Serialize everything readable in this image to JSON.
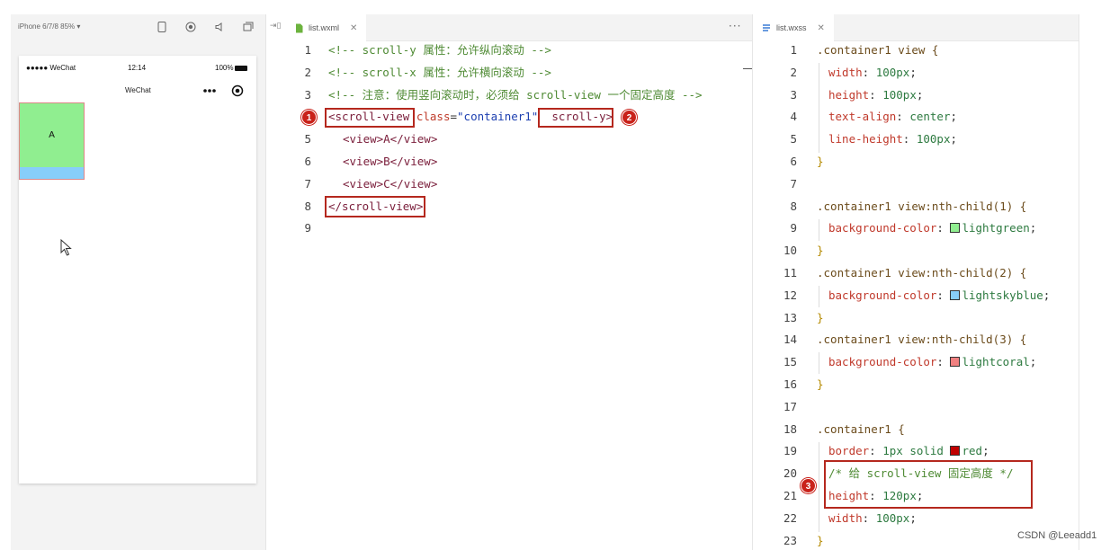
{
  "simulator": {
    "device_label": "iPhone 6/7/8 85% ▾",
    "status": {
      "carrier": "●●●●● WeChat",
      "time": "12:14",
      "battery": "100%"
    },
    "nav_title": "WeChat",
    "view_a_text": "A"
  },
  "wxml": {
    "tab_label": "list.wxml",
    "lines": [
      {
        "n": "1"
      },
      {
        "n": "2"
      },
      {
        "n": "3"
      },
      {
        "n": "4"
      },
      {
        "n": "5"
      },
      {
        "n": "6"
      },
      {
        "n": "7"
      },
      {
        "n": "8"
      },
      {
        "n": "9"
      }
    ],
    "l1": "<!-- scroll-y 属性：允许纵向滚动 -->",
    "l2": "<!-- scroll-x 属性：允许横向滚动 -->",
    "l3": "<!-- 注意：使用竖向滚动时，必须给 scroll-view 一个固定高度 -->",
    "l4_tag": "<scroll-view",
    "l4_attr": "class",
    "l4_eq": "=",
    "l4_str": "\"container1\"",
    "l4_scroll": "scroll-y>",
    "l5": "<view>A</view>",
    "l6": "<view>B</view>",
    "l7": "<view>C</view>",
    "l8": "</scroll-view>",
    "badges": [
      "1",
      "2"
    ]
  },
  "wxss": {
    "tab_label": "list.wxss",
    "line_numbers": [
      "1",
      "2",
      "3",
      "4",
      "5",
      "6",
      "7",
      "8",
      "9",
      "10",
      "11",
      "12",
      "13",
      "14",
      "15",
      "16",
      "17",
      "18",
      "19",
      "20",
      "21",
      "22",
      "23"
    ],
    "l1": ".container1 view {",
    "l2p": "width",
    "l2v": "100px",
    "l3p": "height",
    "l3v": "100px",
    "l4p": "text-align",
    "l4v": "center",
    "l5p": "line-height",
    "l5v": "100px",
    "l6": "}",
    "l8": ".container1 view:nth-child(1) {",
    "l9p": "background-color",
    "l9v": "lightgreen",
    "l10": "}",
    "l11": ".container1 view:nth-child(2) {",
    "l12p": "background-color",
    "l12v": "lightskyblue",
    "l13": "}",
    "l14": ".container1 view:nth-child(3) {",
    "l15p": "background-color",
    "l15v": "lightcoral",
    "l16": "}",
    "l18": ".container1 {",
    "l19p": "border",
    "l19v": "1px solid",
    "l19c": "red",
    "l20": "/* 给 scroll-view 固定高度 */",
    "l21p": "height",
    "l21v": "120px",
    "l22p": "width",
    "l22v": "100px",
    "l23": "}",
    "badge": "3"
  },
  "colors": {
    "lightgreen": "#90ee90",
    "lightskyblue": "#87cefa",
    "lightcoral": "#f08080",
    "red": "#c00000",
    "highlight_box": "#b5281e"
  },
  "watermark": "CSDN @Leeadd1"
}
